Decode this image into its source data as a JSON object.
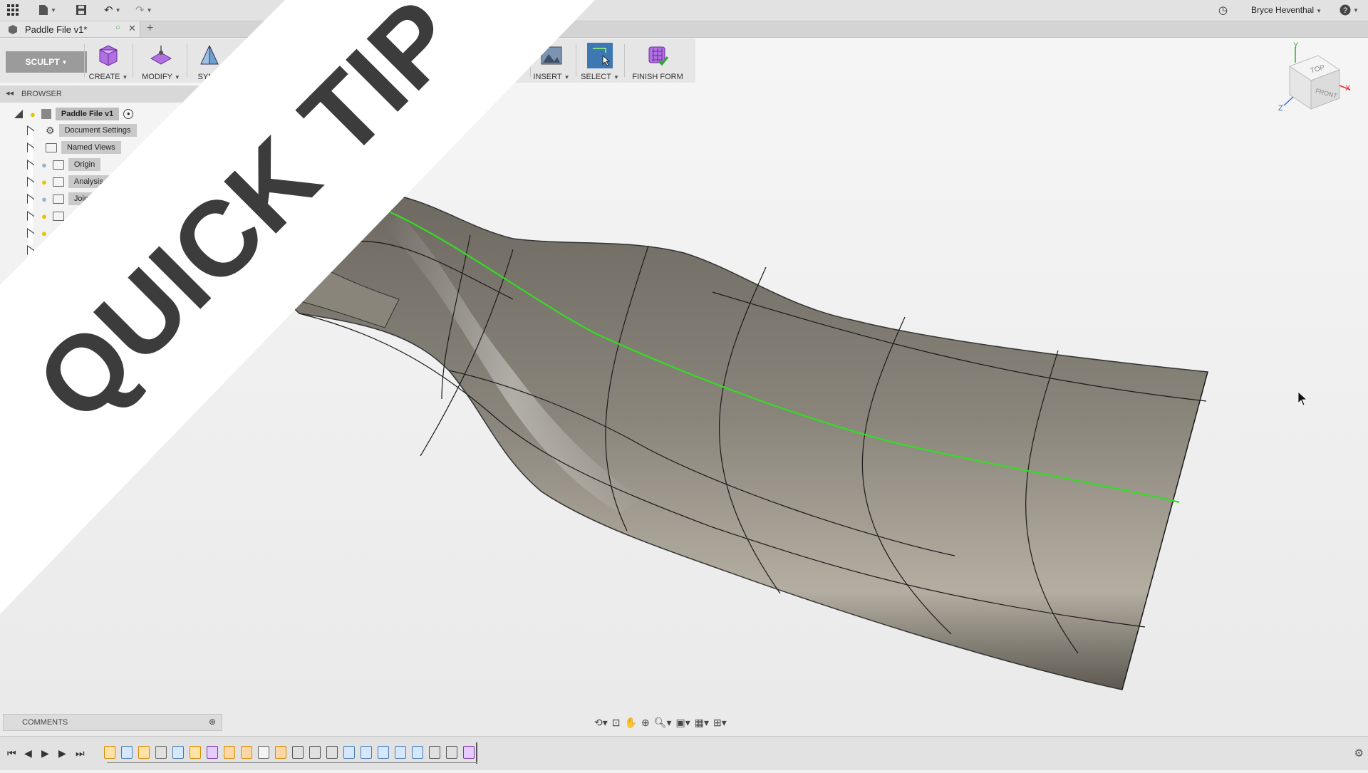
{
  "app": {
    "document_tab_title": "Paddle File v1*",
    "username": "Bryce Heventhal"
  },
  "toolbar": {
    "workspace": "SCULPT",
    "create_label": "CREATE",
    "modify_label": "MODIFY",
    "symmetry_label": "SYMM",
    "insert_label": "INSERT",
    "select_label": "SELECT",
    "finish_form_label": "FINISH FORM"
  },
  "browser": {
    "title": "BROWSER",
    "root": "Paddle File v1",
    "items": [
      {
        "label": "Document Settings",
        "icon": "gear-icon"
      },
      {
        "label": "Named Views",
        "icon": "folder-icon"
      },
      {
        "label": "Origin",
        "icon": "folder-icon"
      },
      {
        "label": "Analysis",
        "icon": "folder-icon"
      },
      {
        "label": "Join",
        "icon": "folder-icon"
      }
    ]
  },
  "viewcube": {
    "top": "TOP",
    "front": "FRONT",
    "axis_x": "X",
    "axis_y": "Y",
    "axis_z": "Z"
  },
  "banner": {
    "text": "QUICK TIP"
  },
  "comments": {
    "label": "COMMENTS"
  },
  "colors": {
    "banner_text": "#3c3c3c",
    "surface": "#7f7a70",
    "highlight_edge": "#33dd22",
    "select_active": "#3d78b2"
  }
}
